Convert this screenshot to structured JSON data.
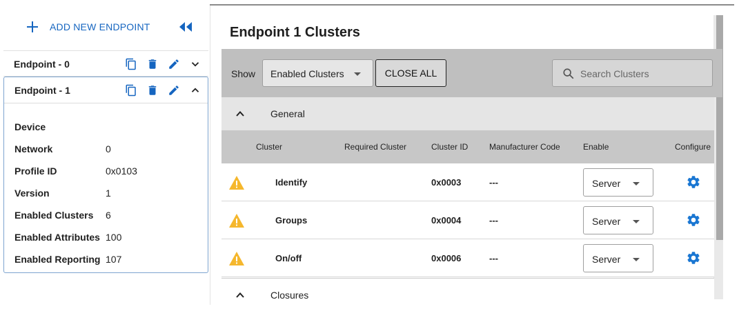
{
  "sidebar": {
    "add_label": "ADD NEW ENDPOINT",
    "endpoints": [
      {
        "title": "Endpoint - 0",
        "expanded": false
      },
      {
        "title": "Endpoint - 1",
        "expanded": true
      }
    ],
    "details": [
      {
        "key": "Device",
        "value": ""
      },
      {
        "key": "Network",
        "value": "0"
      },
      {
        "key": "Profile ID",
        "value": "0x0103"
      },
      {
        "key": "Version",
        "value": "1"
      },
      {
        "key": "Enabled Clusters",
        "value": "6"
      },
      {
        "key": "Enabled Attributes",
        "value": "100"
      },
      {
        "key": "Enabled Reporting",
        "value": "107"
      }
    ]
  },
  "main": {
    "title": "Endpoint 1 Clusters",
    "toolbar": {
      "show_label": "Show",
      "filter_value": "Enabled Clusters",
      "close_all_label": "CLOSE ALL",
      "search_placeholder": "Search Clusters"
    },
    "groups": [
      {
        "label": "General",
        "expanded": true
      },
      {
        "label": "Closures",
        "expanded": true
      }
    ],
    "columns": [
      "Cluster",
      "Required Cluster",
      "Cluster ID",
      "Manufacturer Code",
      "Enable",
      "Configure"
    ],
    "rows": [
      {
        "cluster": "Identify",
        "required": "",
        "cluster_id": "0x0003",
        "manufacturer_code": "---",
        "enable": "Server"
      },
      {
        "cluster": "Groups",
        "required": "",
        "cluster_id": "0x0004",
        "manufacturer_code": "---",
        "enable": "Server"
      },
      {
        "cluster": "On/off",
        "required": "",
        "cluster_id": "0x0006",
        "manufacturer_code": "---",
        "enable": "Server"
      }
    ]
  },
  "colors": {
    "accent": "#1565c0",
    "warning": "#f5b72d",
    "gear": "#1976d2",
    "toolbar_bg": "#bfbfbf",
    "header_bg": "#c7c7c7"
  },
  "icons": {
    "add": "plus-icon",
    "collapse": "double-chevron-left-icon",
    "copy": "copy-icon",
    "delete": "trash-icon",
    "edit": "pencil-icon",
    "expand": "chevron-icon",
    "search": "search-icon",
    "warning": "warning-icon",
    "configure": "gear-icon"
  }
}
